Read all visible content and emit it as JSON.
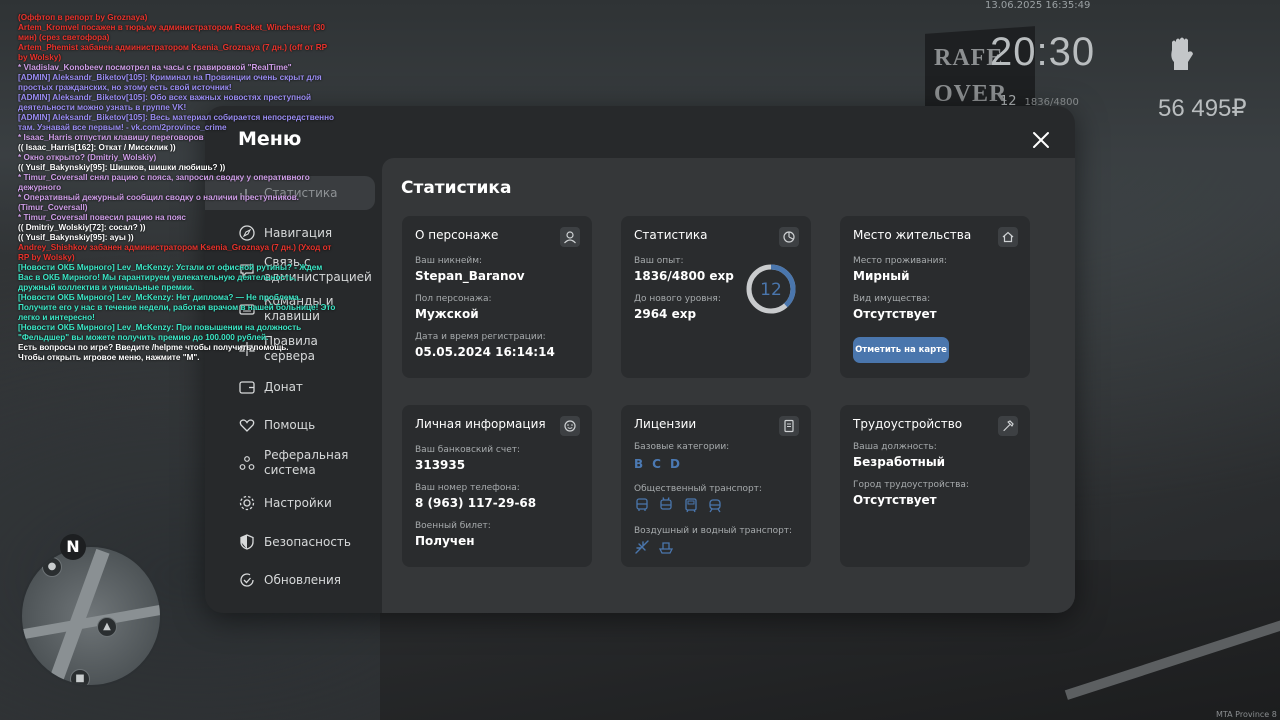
{
  "hud": {
    "datetime": "13.06.2025 16:35:49",
    "clock": "20:30",
    "level": "12",
    "exp_progress": "1836/4800",
    "money": "56 495₽",
    "sign_text_line1": "RAFE",
    "sign_text_line2": "OVER",
    "minimap_north": "N",
    "watermark": "MTA Province 8"
  },
  "chat": [
    {
      "text": "(Оффтоп в репорт by Groznaya)",
      "color": "#e8322b"
    },
    {
      "text": "Artem_Kromvel посажен в тюрьму администратором Rocket_Winchester (30 мин) (срез светофора)",
      "color": "#e8322b"
    },
    {
      "text": "Artem_Phemist забанен администратором Ksenia_Groznaya (7 дн.) (off от RP by Wolsky)",
      "color": "#e8322b"
    },
    {
      "text": "* Vladislav_Konobeev посмотрел на часы с гравировкой \"RealTime\"",
      "color": "#cf9de8"
    },
    {
      "text": "[ADMIN] Aleksandr_Biketov[105]: Криминал на Провинции очень скрыт для простых гражданских, но этому есть свой источник!",
      "color": "#9a8cf2"
    },
    {
      "text": "[ADMIN] Aleksandr_Biketov[105]: Обо всех важных новостях преступной деятельности можно узнать в группе VK!",
      "color": "#9a8cf2"
    },
    {
      "text": "[ADMIN] Aleksandr_Biketov[105]: Весь материал собирается непосредственно там. Узнавай все первым! - vk.com/2province_crime",
      "color": "#9a8cf2"
    },
    {
      "text": "* Isaac_Harris отпустил клавишу переговоров",
      "color": "#cf9de8"
    },
    {
      "text": "(( Isaac_Harris[162]: Откат / Миссклик ))",
      "color": "#ffffff"
    },
    {
      "text": "* Окно открыто? (Dmitriy_Wolskiy)",
      "color": "#cf9de8"
    },
    {
      "text": "(( Yusif_Bakynskiy[95]: Шишков, шишки любишь? ))",
      "color": "#ffffff"
    },
    {
      "text": "* Timur_Coversall снял рацию с пояса, запросил сводку у оперативного дежурного",
      "color": "#cf9de8"
    },
    {
      "text": "* Оперативный дежурный сообщил сводку о наличии преступников. (Timur_Coversall)",
      "color": "#cf9de8"
    },
    {
      "text": "* Timur_Coversall повесил рацию на пояс",
      "color": "#cf9de8"
    },
    {
      "text": "(( Dmitriy_Wolskiy[72]: сосал? ))",
      "color": "#ffffff"
    },
    {
      "text": "(( Yusif_Bakynskiy[95]: ауы ))",
      "color": "#ffffff"
    },
    {
      "text": "Andrey_Shishkov забанен администратором Ksenia_Groznaya (7 дн.) (Уход от RP by Wolsky)",
      "color": "#e8322b"
    },
    {
      "text": "[Новости ОКБ Мирного] Lev_McKenzy: Устали от офисной рутины? - Ждем Вас в ОКБ Мирного! Мы гарантируем увлекательную деятельность, дружный коллектив и уникальные премии.",
      "color": "#3ce6c6"
    },
    {
      "text": "[Новости ОКБ Мирного] Lev_McKenzy: Нет диплома? — Не проблема. Получите его у нас в течение недели, работая врачом в нашей больнице! Это легко и интересно!",
      "color": "#3ce6c6"
    },
    {
      "text": "[Новости ОКБ Мирного] Lev_McKenzy: При повышении на должность \"Фельдшер\" вы можете получить премию до 100.000 рублей.",
      "color": "#3ce6c6"
    },
    {
      "text": "Есть вопросы по игре? Введите /helpme чтобы получить помощь.",
      "color": "#ffffff"
    },
    {
      "text": "Чтобы открыть игровое меню, нажмите \"M\".",
      "color": "#ffffff"
    }
  ],
  "menu": {
    "title": "Меню",
    "sidebar": [
      {
        "label": "Статистика",
        "icon": "chart-icon",
        "active": true
      },
      {
        "label": "Навигация",
        "icon": "compass-icon"
      },
      {
        "label": "Связь с администрацией",
        "icon": "chat-icon"
      },
      {
        "label": "Команды и клавиши",
        "icon": "keyboard-icon"
      },
      {
        "label": "Правила сервера",
        "icon": "rules-icon"
      },
      {
        "label": "Донат",
        "icon": "wallet-icon"
      },
      {
        "label": "Помощь",
        "icon": "heart-hand-icon"
      },
      {
        "label": "Реферальная система",
        "icon": "referral-icon"
      },
      {
        "label": "Настройки",
        "icon": "gear-icon"
      },
      {
        "label": "Безопасность",
        "icon": "shield-icon"
      },
      {
        "label": "Обновления",
        "icon": "refresh-icon"
      }
    ],
    "content_title": "Статистика",
    "cards": {
      "character": {
        "title": "О персонаже",
        "nickname_label": "Ваш никнейм:",
        "nickname": "Stepan_Baranov",
        "gender_label": "Пол персонажа:",
        "gender": "Мужской",
        "reg_label": "Дата и время регистрации:",
        "reg_date": "05.05.2024 16:14:14"
      },
      "stats": {
        "title": "Статистика",
        "exp_label": "Ваш опыт:",
        "exp": "1836/4800 exp",
        "next_label": "До нового уровня:",
        "next": "2964 exp",
        "level": "12",
        "progress": 0.3825
      },
      "residence": {
        "title": "Место жительства",
        "place_label": "Место проживания:",
        "place": "Мирный",
        "property_label": "Вид имущества:",
        "property": "Отсутствует",
        "button": "Отметить на карте"
      },
      "personal": {
        "title": "Личная информация",
        "bank_label": "Ваш банковский счет:",
        "bank": "313935",
        "phone_label": "Ваш номер телефона:",
        "phone": "8 (963) 117-29-68",
        "military_label": "Военный билет:",
        "military": "Получен"
      },
      "licenses": {
        "title": "Лицензии",
        "base_label": "Базовые категории:",
        "base": [
          "B",
          "C",
          "D"
        ],
        "public_label": "Общественный транспорт:",
        "air_label": "Воздушный и водный транспорт:"
      },
      "job": {
        "title": "Трудоустройство",
        "position_label": "Ваша должность:",
        "position": "Безработный",
        "city_label": "Город трудоустройства:",
        "city": "Отсутствует"
      }
    }
  }
}
